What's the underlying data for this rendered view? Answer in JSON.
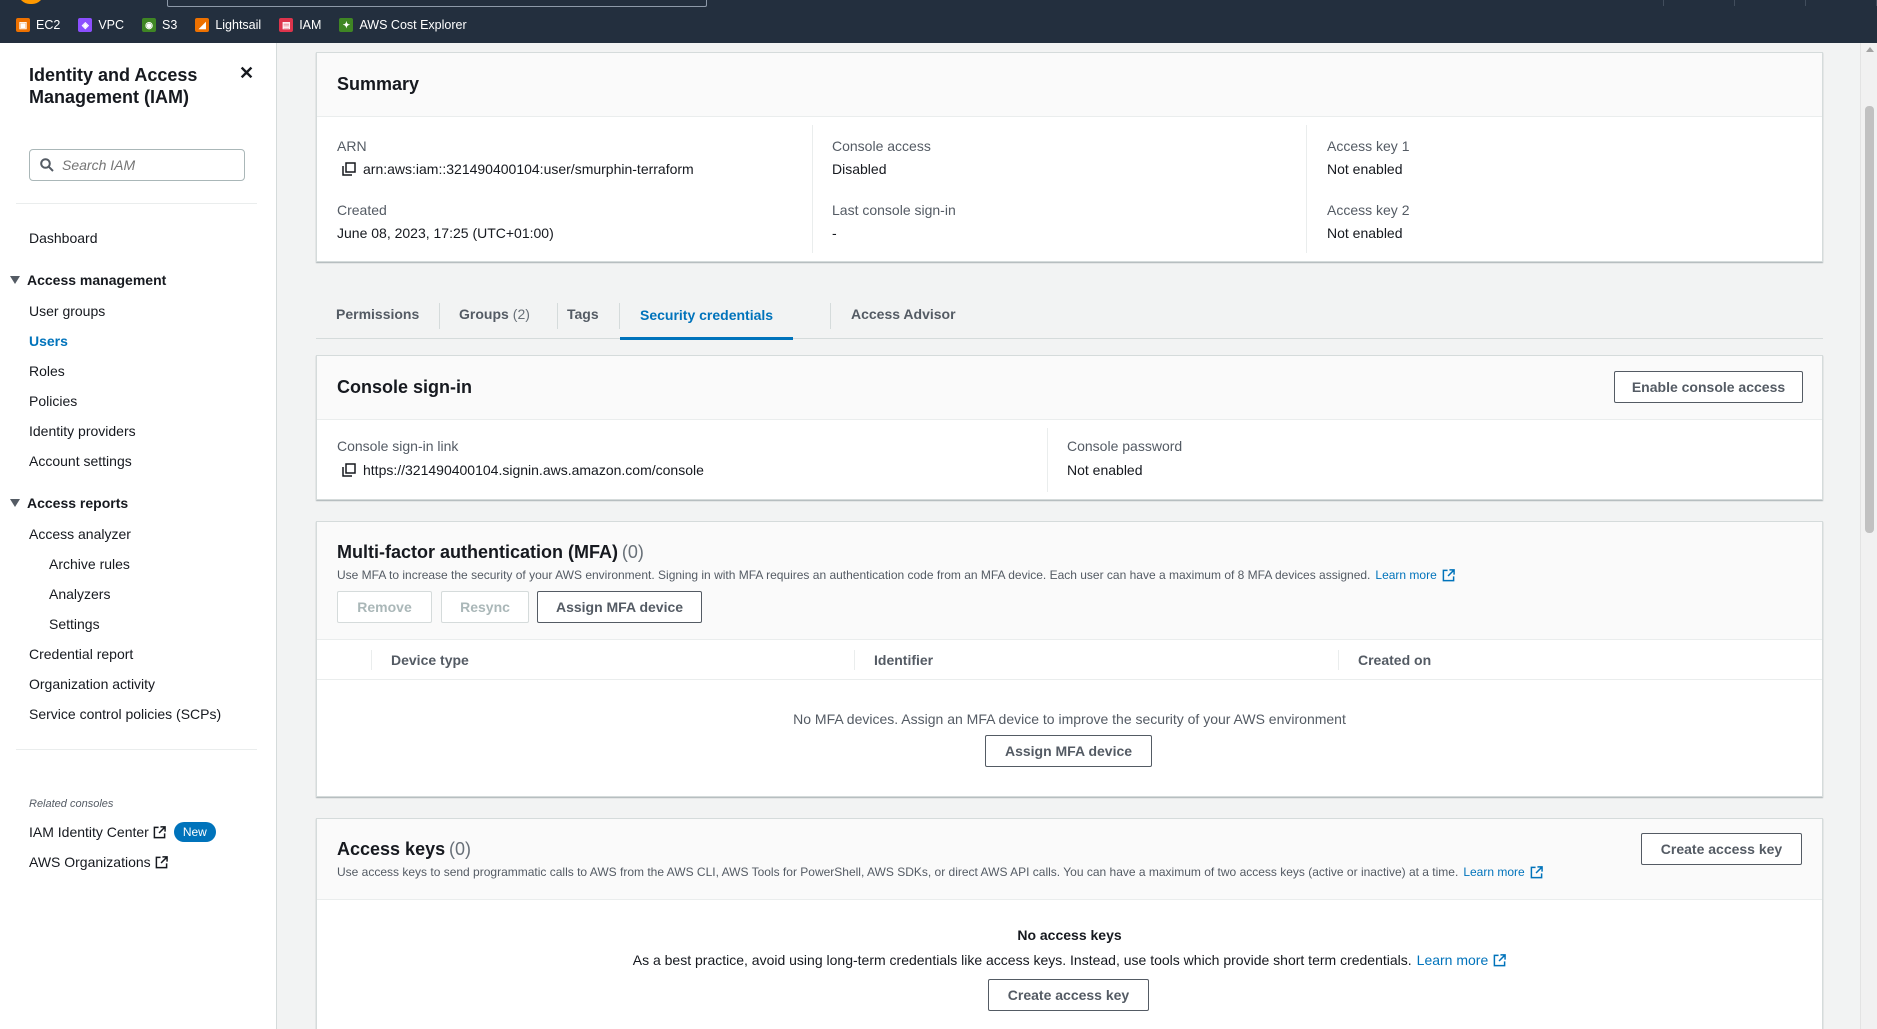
{
  "favorites": [
    {
      "label": "EC2",
      "color": "#ed7100",
      "icon": "ec2-icon"
    },
    {
      "label": "VPC",
      "color": "#8c4fff",
      "icon": "vpc-icon"
    },
    {
      "label": "S3",
      "color": "#3f8624",
      "icon": "s3-icon"
    },
    {
      "label": "Lightsail",
      "color": "#ed7100",
      "icon": "lightsail-icon"
    },
    {
      "label": "IAM",
      "color": "#dd344c",
      "icon": "iam-icon"
    },
    {
      "label": "AWS Cost Explorer",
      "color": "#3f8624",
      "icon": "cost-explorer-icon"
    }
  ],
  "sidebar": {
    "title": "Identity and Access Management (IAM)",
    "search_placeholder": "Search IAM",
    "dashboard": "Dashboard",
    "access_management": {
      "label": "Access management",
      "items": [
        "User groups",
        "Users",
        "Roles",
        "Policies",
        "Identity providers",
        "Account settings"
      ]
    },
    "access_reports": {
      "label": "Access reports",
      "items": [
        "Access analyzer",
        "Archive rules",
        "Analyzers",
        "Settings",
        "Credential report",
        "Organization activity",
        "Service control policies (SCPs)"
      ]
    },
    "related_consoles_label": "Related consoles",
    "identity_center": "IAM Identity Center",
    "new_badge": "New",
    "organizations": "AWS Organizations"
  },
  "summary": {
    "title": "Summary",
    "arn_label": "ARN",
    "arn_value": "arn:aws:iam::321490400104:user/smurphin-terraform",
    "created_label": "Created",
    "created_value": "June 08, 2023, 17:25 (UTC+01:00)",
    "console_access_label": "Console access",
    "console_access_value": "Disabled",
    "last_signin_label": "Last console sign-in",
    "last_signin_value": "-",
    "access_key1_label": "Access key 1",
    "access_key1_value": "Not enabled",
    "access_key2_label": "Access key 2",
    "access_key2_value": "Not enabled"
  },
  "tabs": {
    "permissions": "Permissions",
    "groups": "Groups",
    "groups_count": "(2)",
    "tags": "Tags",
    "security_credentials": "Security credentials",
    "access_advisor": "Access Advisor"
  },
  "console_signin": {
    "title": "Console sign-in",
    "enable_button": "Enable console access",
    "link_label": "Console sign-in link",
    "link_value": "https://321490400104.signin.aws.amazon.com/console",
    "password_label": "Console password",
    "password_value": "Not enabled"
  },
  "mfa": {
    "title": "Multi-factor authentication (MFA)",
    "count": "(0)",
    "description": "Use MFA to increase the security of your AWS environment. Signing in with MFA requires an authentication code from an MFA device. Each user can have a maximum of 8 MFA devices assigned.",
    "learn_more": "Learn more",
    "remove_button": "Remove",
    "resync_button": "Resync",
    "assign_button": "Assign MFA device",
    "columns": [
      "Device type",
      "Identifier",
      "Created on"
    ],
    "empty_text": "No MFA devices. Assign an MFA device to improve the security of your AWS environment",
    "empty_assign_button": "Assign MFA device"
  },
  "access_keys": {
    "title": "Access keys",
    "count": "(0)",
    "description": "Use access keys to send programmatic calls to AWS from the AWS CLI, AWS Tools for PowerShell, AWS SDKs, or direct AWS API calls. You can have a maximum of two access keys (active or inactive) at a time.",
    "learn_more": "Learn more",
    "create_button": "Create access key",
    "empty_title": "No access keys",
    "empty_text": "As a best practice, avoid using long-term credentials like access keys. Instead, use tools which provide short term credentials.",
    "empty_learn_more": "Learn more",
    "empty_create_button": "Create access key"
  }
}
